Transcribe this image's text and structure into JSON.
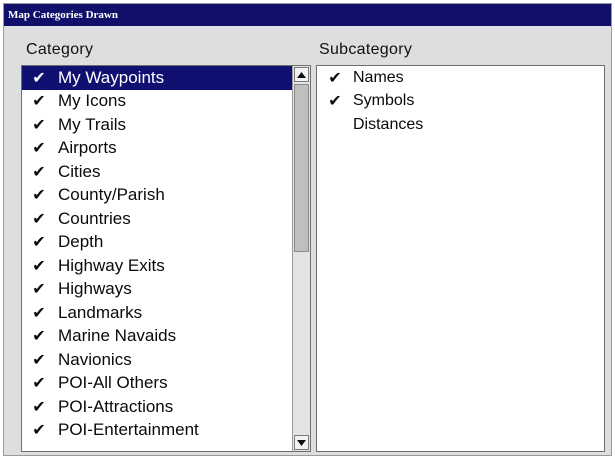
{
  "window": {
    "title": "Map Categories Drawn"
  },
  "category": {
    "label": "Category",
    "items": [
      {
        "label": "My Waypoints",
        "checked": true,
        "selected": true
      },
      {
        "label": "My Icons",
        "checked": true
      },
      {
        "label": "My Trails",
        "checked": true
      },
      {
        "label": "Airports",
        "checked": true
      },
      {
        "label": "Cities",
        "checked": true
      },
      {
        "label": "County/Parish",
        "checked": true
      },
      {
        "label": "Countries",
        "checked": true
      },
      {
        "label": "Depth",
        "checked": true
      },
      {
        "label": "Highway Exits",
        "checked": true
      },
      {
        "label": "Highways",
        "checked": true
      },
      {
        "label": "Landmarks",
        "checked": true
      },
      {
        "label": "Marine Navaids",
        "checked": true
      },
      {
        "label": "Navionics",
        "checked": true
      },
      {
        "label": "POI-All Others",
        "checked": true
      },
      {
        "label": "POI-Attractions",
        "checked": true
      },
      {
        "label": "POI-Entertainment",
        "checked": true
      }
    ]
  },
  "subcategory": {
    "label": "Subcategory",
    "items": [
      {
        "label": "Names",
        "checked": true
      },
      {
        "label": "Symbols",
        "checked": true
      },
      {
        "label": "Distances",
        "checked": false
      }
    ]
  },
  "icons": {
    "check": "checkmark-icon",
    "scroll_up": "arrow-up-icon",
    "scroll_down": "arrow-down-icon"
  },
  "colors": {
    "title_bar": "#10106a",
    "selection": "#101070",
    "panel_bg": "#dddee0"
  }
}
